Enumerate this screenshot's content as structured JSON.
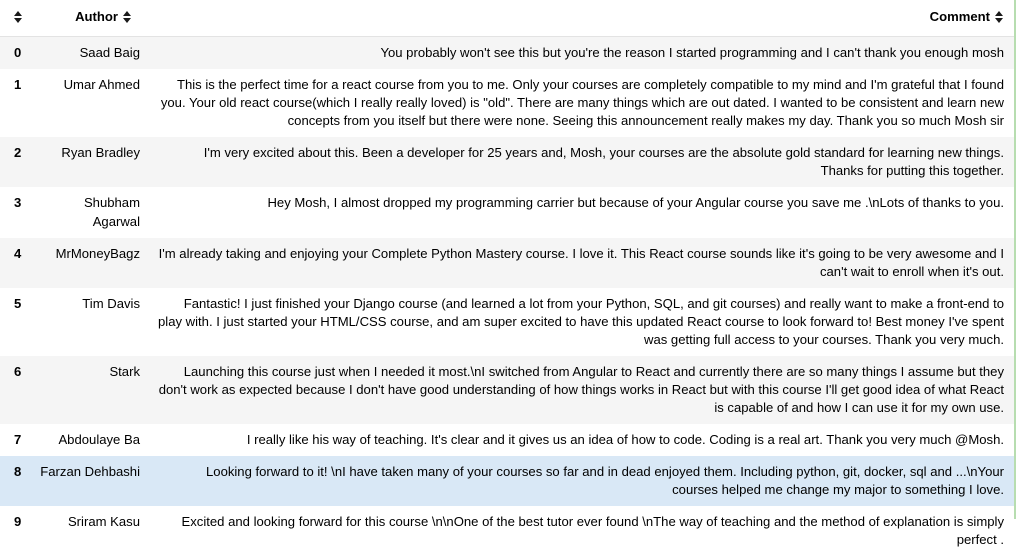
{
  "table": {
    "columns": [
      {
        "key": "index",
        "label": "",
        "sort_icon": "sort-updown-icon"
      },
      {
        "key": "author",
        "label": "Author",
        "sort_icon": "sort-updown-icon"
      },
      {
        "key": "comment",
        "label": "Comment",
        "sort_icon": "sort-updown-icon"
      }
    ],
    "rows": [
      {
        "index": "0",
        "author": "Saad Baig",
        "comment": "You probably won't see this but you're the reason I started programming and I can't thank you enough mosh",
        "state": "stripe"
      },
      {
        "index": "1",
        "author": "Umar Ahmed",
        "comment": "This is the perfect time for a react course from you to me. Only your courses are completely compatible to my mind and I'm grateful that I found you. Your old react course(which I really really loved) is \"old\". There are many things which are out dated. I wanted to be consistent and learn new concepts from you itself but there were none. Seeing this announcement really makes my day. Thank you so much Mosh sir",
        "state": "plain"
      },
      {
        "index": "2",
        "author": "Ryan Bradley",
        "comment": "I'm very excited about this. Been a developer for 25 years and, Mosh, your courses are the absolute gold standard for learning new things. Thanks for putting this together.",
        "state": "stripe"
      },
      {
        "index": "3",
        "author": "Shubham Agarwal",
        "comment": "Hey Mosh, I almost dropped my programming carrier but because of your Angular course you save me .\\nLots of thanks to you.",
        "state": "plain"
      },
      {
        "index": "4",
        "author": "MrMoneyBagz",
        "comment": "I'm already taking and enjoying your Complete Python Mastery course. I love it. This React course sounds like it's going to be very awesome and I can't wait to enroll when it's out.",
        "state": "stripe"
      },
      {
        "index": "5",
        "author": "Tim Davis",
        "comment": "Fantastic! I just finished your Django course (and learned a lot from your Python, SQL, and git courses) and really want to make a front-end to play with. I just started your HTML/CSS course, and am super excited to have this updated React course to look forward to! Best money I've spent was getting full access to your courses. Thank you very much.",
        "state": "plain"
      },
      {
        "index": "6",
        "author": "Stark",
        "comment": "Launching this course just when I needed it most.\\nI switched from Angular to React and currently there are so many things I assume but they don't work as expected because I don't have good understanding of how things works in React but with this course I'll get good idea of what React is capable of and how I can use it for my own use.",
        "state": "stripe"
      },
      {
        "index": "7",
        "author": "Abdoulaye Ba",
        "comment": "I really like his way of teaching. It's clear and it gives us an idea of how to code. Coding is a real art. Thank you very much @Mosh.",
        "state": "plain"
      },
      {
        "index": "8",
        "author": "Farzan Dehbashi",
        "comment": "Looking forward to it! \\nI have taken many of your courses so far and in dead enjoyed them. Including python, git, docker, sql and ...\\nYour courses helped me change my major to something I love.",
        "state": "hover"
      },
      {
        "index": "9",
        "author": "Sriram Kasu",
        "comment": "Excited and looking forward for this course \\n\\nOne of the best tutor ever found \\nThe way of teaching and the method of explanation is simply perfect .",
        "state": "plain"
      }
    ]
  },
  "colors": {
    "stripe_row": "#f5f5f5",
    "hover_row": "#d9e8f6",
    "header_border": "#e3e3e3",
    "right_rule": "#b7ddb0",
    "text": "#000000"
  }
}
